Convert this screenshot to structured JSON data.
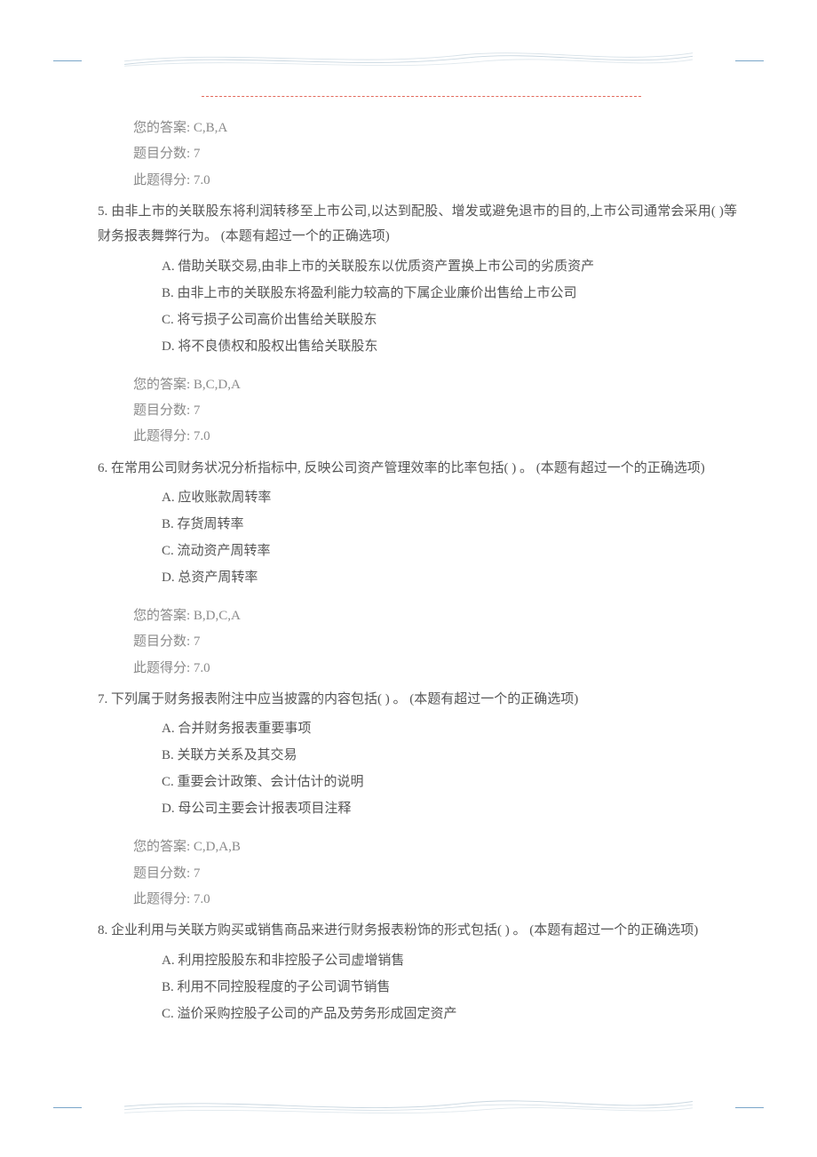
{
  "labels": {
    "your_answer_prefix": "您的答案:",
    "question_score_prefix": "题目分数:",
    "obtained_score_prefix": "此题得分:"
  },
  "q4_answer": {
    "your_answer": "C,B,A",
    "question_score": "7",
    "obtained_score": "7.0"
  },
  "questions": [
    {
      "number": "5.",
      "stem": "由非上市的关联股东将利润转移至上市公司,以达到配股、增发或避免退市的目的,上市公司通常会采用(  )等财务报表舞弊行为。 (本题有超过一个的正确选项)",
      "options": [
        "A. 借助关联交易,由非上市的关联股东以优质资产置换上市公司的劣质资产",
        "B. 由非上市的关联股东将盈利能力较高的下属企业廉价出售给上市公司",
        "C. 将亏损子公司高价出售给关联股东",
        "D. 将不良债权和股权出售给关联股东"
      ],
      "your_answer": "B,C,D,A",
      "question_score": "7",
      "obtained_score": "7.0"
    },
    {
      "number": "6.",
      "stem": "在常用公司财务状况分析指标中, 反映公司资产管理效率的比率包括(  ) 。 (本题有超过一个的正确选项)",
      "options": [
        "A. 应收账款周转率",
        "B. 存货周转率",
        "C. 流动资产周转率",
        "D. 总资产周转率"
      ],
      "your_answer": "B,D,C,A",
      "question_score": "7",
      "obtained_score": "7.0"
    },
    {
      "number": "7.",
      "stem": "下列属于财务报表附注中应当披露的内容包括(  ) 。 (本题有超过一个的正确选项)",
      "options": [
        "A. 合并财务报表重要事项",
        "B. 关联方关系及其交易",
        "C. 重要会计政策、会计估计的说明",
        "D. 母公司主要会计报表项目注释"
      ],
      "your_answer": "C,D,A,B",
      "question_score": "7",
      "obtained_score": "7.0"
    },
    {
      "number": "8.",
      "stem": "企业利用与关联方购买或销售商品来进行财务报表粉饰的形式包括(  ) 。 (本题有超过一个的正确选项)",
      "options": [
        "A. 利用控股股东和非控股子公司虚增销售",
        "B. 利用不同控股程度的子公司调节销售",
        "C. 溢价采购控股子公司的产品及劳务形成固定资产"
      ]
    }
  ]
}
